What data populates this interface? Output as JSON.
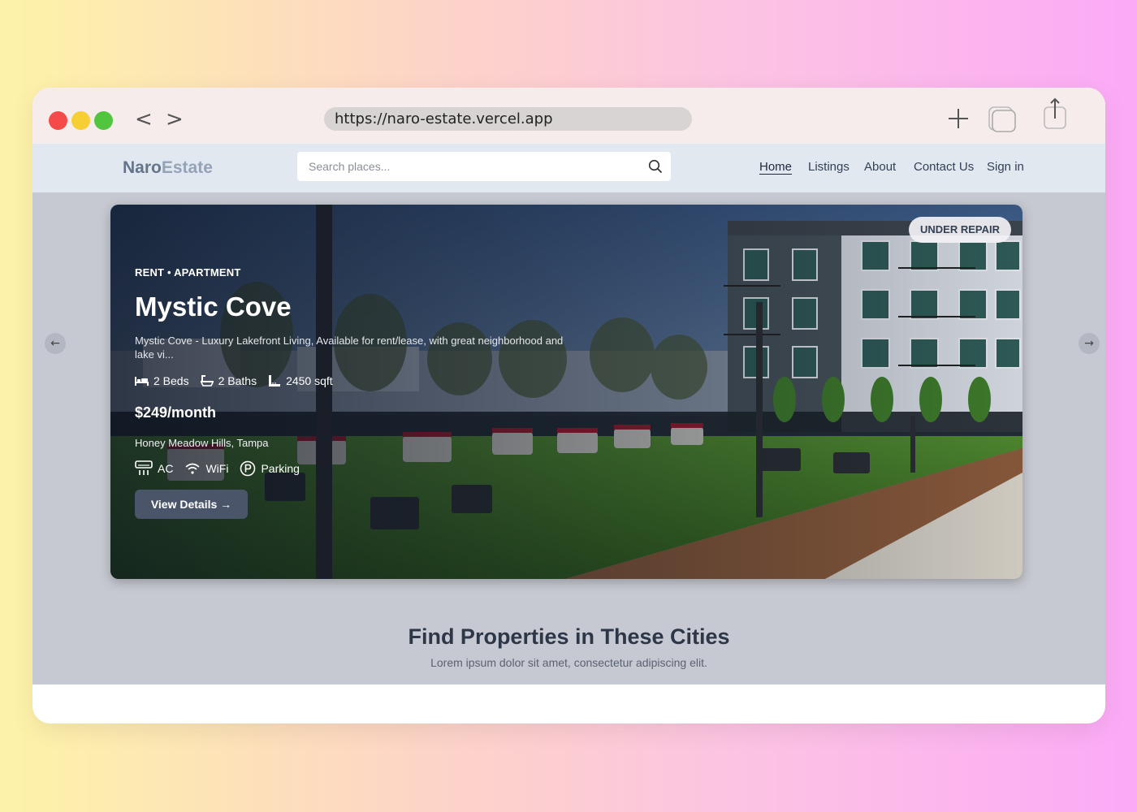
{
  "browser": {
    "url": "https://naro-estate.vercel.app",
    "back_glyph": "<",
    "forward_glyph": ">"
  },
  "site": {
    "logo_part1": "Naro",
    "logo_part2": "Estate",
    "search_placeholder": "Search places...",
    "nav": [
      "Home",
      "Listings",
      "About",
      "Contact Us",
      "Sign in"
    ]
  },
  "hero": {
    "badge": "UNDER REPAIR",
    "type_line": "RENT • APARTMENT",
    "title": "Mystic Cove",
    "description": "Mystic Cove - Luxury Lakefront Living, Available for rent/lease, with great neighborhood and lake vi...",
    "beds": "2 Beds",
    "baths": "2 Baths",
    "area": "2450 sqft",
    "price": "$249/month",
    "location": "Honey Meadow Hills, Tampa",
    "amenities": [
      "AC",
      "WiFi",
      "Parking"
    ],
    "cta": "View Details →",
    "prev_glyph": "←",
    "next_glyph": "→"
  },
  "cities": {
    "title": "Find Properties in These Cities",
    "subtitle": "Lorem ipsum dolor sit amet, consectetur adipiscing elit."
  },
  "colors": {
    "page_bg_left": "#fdf3a8",
    "page_bg_right": "#fbaaf6",
    "header_bg": "#e2e8f0",
    "content_bg": "#c7c9d2",
    "button_bg": "#4b5569"
  }
}
